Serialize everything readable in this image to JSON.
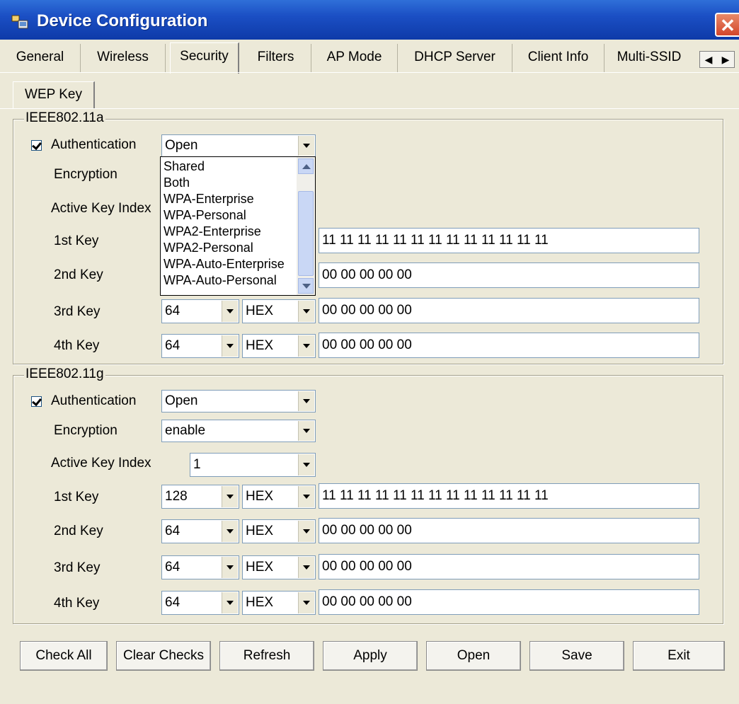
{
  "window": {
    "title": "Device Configuration",
    "close_glyph": "✕"
  },
  "tabs": [
    {
      "label": "General"
    },
    {
      "label": "Wireless"
    },
    {
      "label": "Security"
    },
    {
      "label": "Filters"
    },
    {
      "label": "AP Mode"
    },
    {
      "label": "DHCP Server"
    },
    {
      "label": "Client Info"
    },
    {
      "label": "Multi-SSID"
    }
  ],
  "active_tab": "Security",
  "subtab": {
    "label": "WEP Key"
  },
  "group_a": {
    "legend": "IEEE802.11a",
    "auth_label": "Authentication",
    "auth_value": "Open",
    "auth_checked": true,
    "enc_label": "Encryption",
    "active_key_label": "Active Key Index",
    "keys": [
      {
        "label": "1st Key",
        "length": "",
        "format": "",
        "value": "11 11 11 11 11 11 11 11 11 11 11 11 11"
      },
      {
        "label": "2nd Key",
        "length": "",
        "format": "",
        "value": "00 00 00 00 00"
      },
      {
        "label": "3rd Key",
        "length": "64",
        "format": "HEX",
        "value": "00 00 00 00 00"
      },
      {
        "label": "4th Key",
        "length": "64",
        "format": "HEX",
        "value": "00 00 00 00 00"
      }
    ]
  },
  "dropdown": {
    "options": [
      "Shared",
      "Both",
      "WPA-Enterprise",
      "WPA-Personal",
      "WPA2-Enterprise",
      "WPA2-Personal",
      "WPA-Auto-Enterprise",
      "WPA-Auto-Personal"
    ]
  },
  "group_g": {
    "legend": "IEEE802.11g",
    "auth_label": "Authentication",
    "auth_value": "Open",
    "auth_checked": true,
    "enc_label": "Encryption",
    "enc_value": "enable",
    "active_key_label": "Active Key Index",
    "active_key_value": "1",
    "keys": [
      {
        "label": "1st Key",
        "length": "128",
        "format": "HEX",
        "value": "11 11 11 11 11 11 11 11 11 11 11 11 11"
      },
      {
        "label": "2nd Key",
        "length": "64",
        "format": "HEX",
        "value": "00 00 00 00 00"
      },
      {
        "label": "3rd Key",
        "length": "64",
        "format": "HEX",
        "value": "00 00 00 00 00"
      },
      {
        "label": "4th Key",
        "length": "64",
        "format": "HEX",
        "value": "00 00 00 00 00"
      }
    ]
  },
  "buttons": {
    "check_all": "Check All",
    "clear_checks": "Clear Checks",
    "refresh": "Refresh",
    "apply": "Apply",
    "open": "Open",
    "save": "Save",
    "exit": "Exit"
  },
  "colors": {
    "titlebar": "#1b4fc4",
    "window_bg": "#ece9d8",
    "close_button": "#d3452a"
  }
}
